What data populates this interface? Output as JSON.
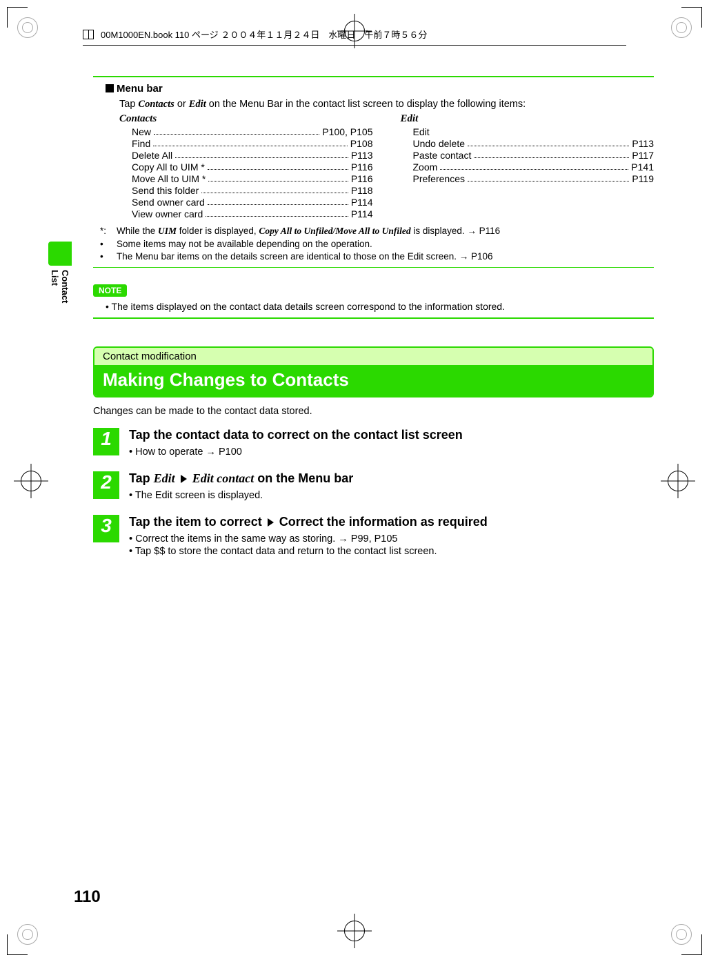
{
  "header": {
    "file_info": "00M1000EN.book  110 ページ  ２００４年１１月２４日　水曜日　午前７時５６分"
  },
  "side_tab": "Contact List",
  "menu": {
    "heading": "Menu bar",
    "intro_1": "Tap ",
    "intro_contacts": "Contacts",
    "intro_or": " or ",
    "intro_edit": "Edit",
    "intro_2": " on the Menu Bar in the contact list screen to display the following items:",
    "col1_head": "Contacts",
    "col1": [
      {
        "label": "New",
        "page": "P100, P105"
      },
      {
        "label": "Find",
        "page": "P108"
      },
      {
        "label": "Delete All",
        "page": "P113"
      },
      {
        "label": "Copy All to UIM *",
        "page": "P116"
      },
      {
        "label": "Move All to UIM *",
        "page": "P116"
      },
      {
        "label": "Send this folder",
        "page": "P118"
      },
      {
        "label": "Send owner card",
        "page": "P114"
      },
      {
        "label": "View owner card",
        "page": "P114"
      }
    ],
    "col2_head": "Edit",
    "col2": [
      {
        "label": "Edit",
        "page": ""
      },
      {
        "label": "Undo delete",
        "page": "P113"
      },
      {
        "label": "Paste contact",
        "page": "P117"
      },
      {
        "label": "Zoom",
        "page": "P141"
      },
      {
        "label": "Preferences",
        "page": "P119"
      }
    ],
    "foot1_lab": "*:",
    "foot1_a": "While the ",
    "foot1_uim": "UIM",
    "foot1_b": " folder is displayed, ",
    "foot1_copy": "Copy All to Unfiled/Move All to Unfiled",
    "foot1_c": " is displayed. → P116",
    "foot2_lab": "•",
    "foot2": "Some items may not be available depending on the operation.",
    "foot3_lab": "•",
    "foot3": "The Menu bar items on the details screen are identical to those on the Edit screen. → P106"
  },
  "note": {
    "label": "NOTE",
    "text": "The items displayed on the contact data details screen correspond to the information stored."
  },
  "section": {
    "sub": "Contact modification",
    "title": "Making Changes to Contacts",
    "intro": "Changes can be made to the contact data stored."
  },
  "steps": [
    {
      "num": "1",
      "head": "Tap the contact data to correct on the contact list screen",
      "bullets": [
        "How to operate → P100"
      ]
    },
    {
      "num": "2",
      "head_parts": {
        "a": "Tap ",
        "e1": "Edit",
        "e2": "Edit contact",
        "b": " on the Menu bar"
      },
      "bullets": [
        "The Edit screen is displayed."
      ]
    },
    {
      "num": "3",
      "head_parts": {
        "a": "Tap the item to correct ",
        "b": " Correct the information as required"
      },
      "bullets": [
        "Correct the items in the same way as storing. → P99, P105",
        "Tap $$ to store the contact data and return to the contact list screen."
      ]
    }
  ],
  "page_number": "110"
}
